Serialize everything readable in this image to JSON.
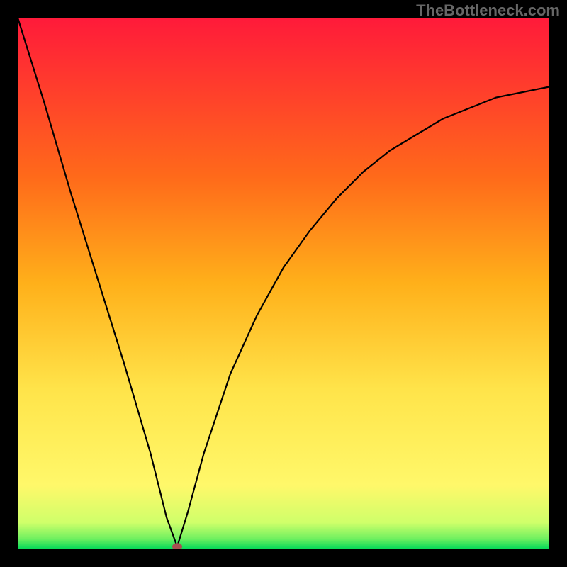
{
  "watermark": "TheBottleneck.com",
  "chart_data": {
    "type": "line",
    "title": "",
    "xlabel": "",
    "ylabel": "",
    "xlim": [
      0,
      100
    ],
    "ylim": [
      0,
      100
    ],
    "description": "Bottleneck curve on a red-to-green vertical gradient background. V-shaped curve with minimum near x=30. Left branch is nearly straight/steep, right branch rises with decreasing slope (concave). A small red-brown dot marks the minimum just above the narrow green band at the bottom.",
    "background_gradient": [
      "#ff1a3a",
      "#ff8a1a",
      "#ffd21a",
      "#fff44a",
      "#b8ff5a",
      "#00e060"
    ],
    "series": [
      {
        "name": "bottleneck-curve",
        "x": [
          0,
          5,
          10,
          15,
          20,
          25,
          28,
          30,
          32,
          35,
          40,
          45,
          50,
          55,
          60,
          65,
          70,
          75,
          80,
          85,
          90,
          95,
          100
        ],
        "values": [
          100,
          84,
          67,
          51,
          35,
          18,
          6,
          0.5,
          7,
          18,
          33,
          44,
          53,
          60,
          66,
          71,
          75,
          78,
          81,
          83,
          85,
          86,
          87
        ]
      }
    ],
    "min_point": {
      "x": 30,
      "y": 0.5
    },
    "dot_color": "#a85050"
  }
}
